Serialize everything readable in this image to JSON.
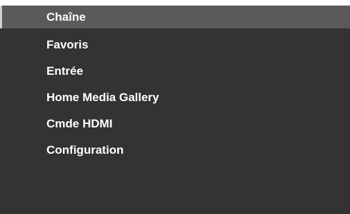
{
  "menu": {
    "selected_index": 0,
    "items": [
      {
        "label": "Chaîne"
      },
      {
        "label": "Favoris"
      },
      {
        "label": "Entrée"
      },
      {
        "label": "Home Media Gallery"
      },
      {
        "label": "Cmde HDMI"
      },
      {
        "label": "Configuration"
      }
    ]
  },
  "colors": {
    "panel_background": "#333333",
    "selected_background": "#5a5a5a",
    "text": "#ffffff"
  }
}
